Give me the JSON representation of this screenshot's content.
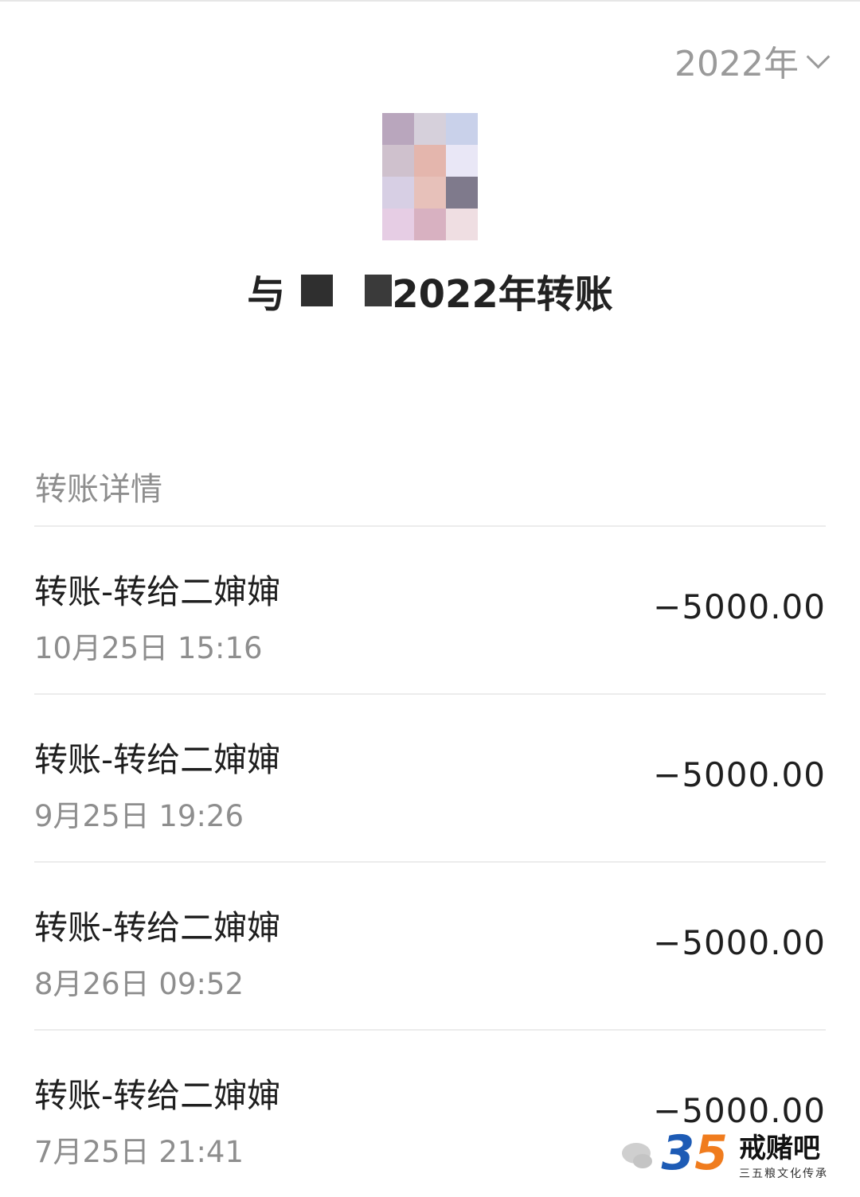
{
  "header": {
    "year_label": "2022年"
  },
  "title": {
    "prefix": "与",
    "suffix": "2022年转账"
  },
  "section": {
    "label": "转账详情"
  },
  "transactions": [
    {
      "name": "转账-转给二婶婶",
      "time": "10月25日 15:16",
      "amount": "−5000.00"
    },
    {
      "name": "转账-转给二婶婶",
      "time": "9月25日 19:26",
      "amount": "−5000.00"
    },
    {
      "name": "转账-转给二婶婶",
      "time": "8月26日 09:52",
      "amount": "−5000.00"
    },
    {
      "name": "转账-转给二婶婶",
      "time": "7月25日 21:41",
      "amount": "−5000.00"
    }
  ],
  "watermark": {
    "number_a": "3",
    "number_b": "5",
    "brand": "戒赌吧",
    "tagline": "三五粮文化传承"
  },
  "colors": {
    "muted": "#8e8e8e",
    "divider": "#ececec",
    "brand_orange": "#f07c1e",
    "brand_blue": "#1d5bb5"
  }
}
